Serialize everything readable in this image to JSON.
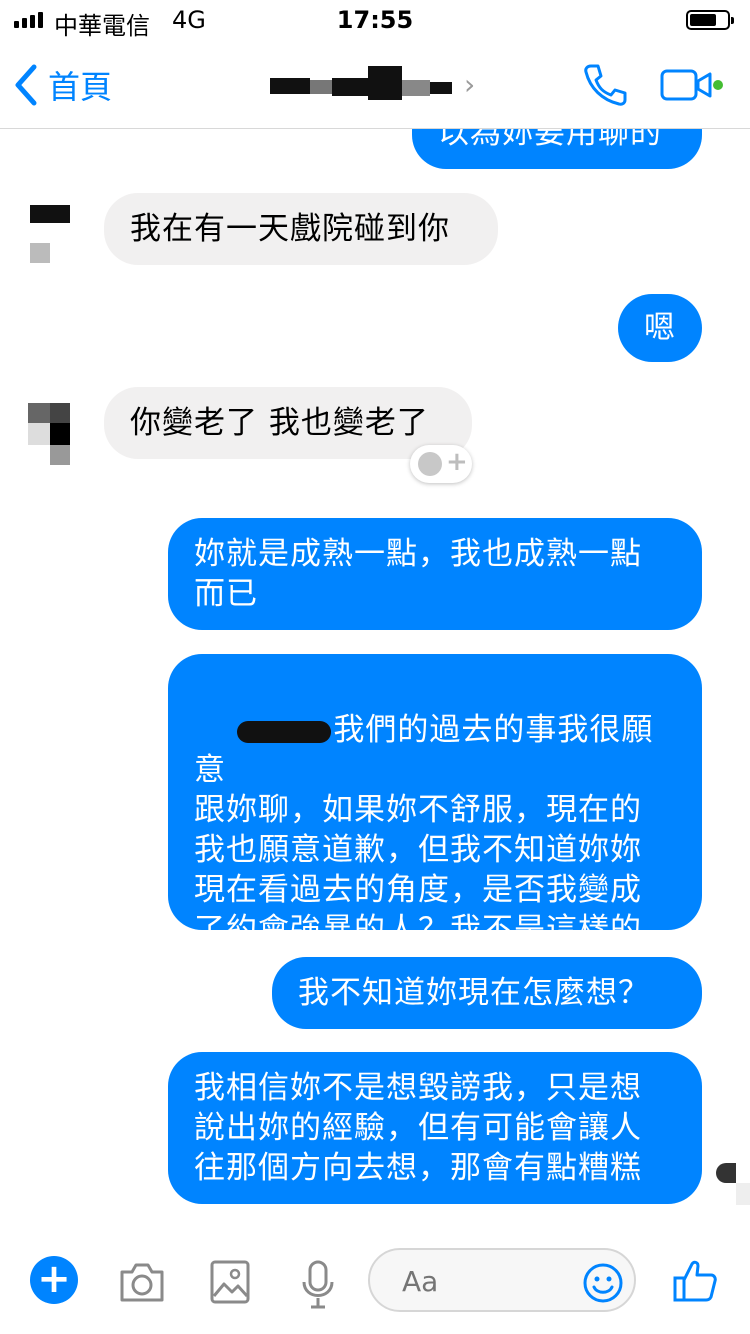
{
  "status_bar": {
    "carrier": "中華電信",
    "network": "4G",
    "time": "17:55"
  },
  "header": {
    "back_label": "首頁",
    "icons": {
      "back": "chevron-left-icon",
      "call": "phone-icon",
      "video": "video-camera-icon",
      "active": "online-dot"
    },
    "accent": "#0084ff",
    "online_color": "#44bd32"
  },
  "messages": [
    {
      "side": "out",
      "text": "以為妳要用聊的"
    },
    {
      "side": "in",
      "text": "我在有一天戲院碰到你"
    },
    {
      "side": "out",
      "text": "嗯"
    },
    {
      "side": "in",
      "text": "你變老了 我也變老了"
    },
    {
      "side": "out",
      "text": "妳就是成熟一點，我也成熟一點\n而已"
    },
    {
      "side": "out",
      "text": "我們的過去的事我很願意\n跟妳聊，如果妳不舒服，現在的\n我也願意道歉，但我不知道妳妳\n現在看過去的角度，是否我變成\n了約會強暴的人？我不是這樣的\n人！"
    },
    {
      "side": "out",
      "text": "我不知道妳現在怎麼想？"
    },
    {
      "side": "out",
      "text": "我相信妳不是想毀謗我，只是想\n說出妳的經驗，但有可能會讓人\n往那個方向去想，那會有點糟糕"
    }
  ],
  "composer": {
    "placeholder": "Aa",
    "icons": [
      "plus-icon",
      "camera-icon",
      "image-icon",
      "microphone-icon",
      "emoji-icon",
      "thumbs-up-icon"
    ]
  },
  "colors": {
    "outgoing_bubble": "#0084ff",
    "incoming_bubble": "#f1f0f0"
  }
}
